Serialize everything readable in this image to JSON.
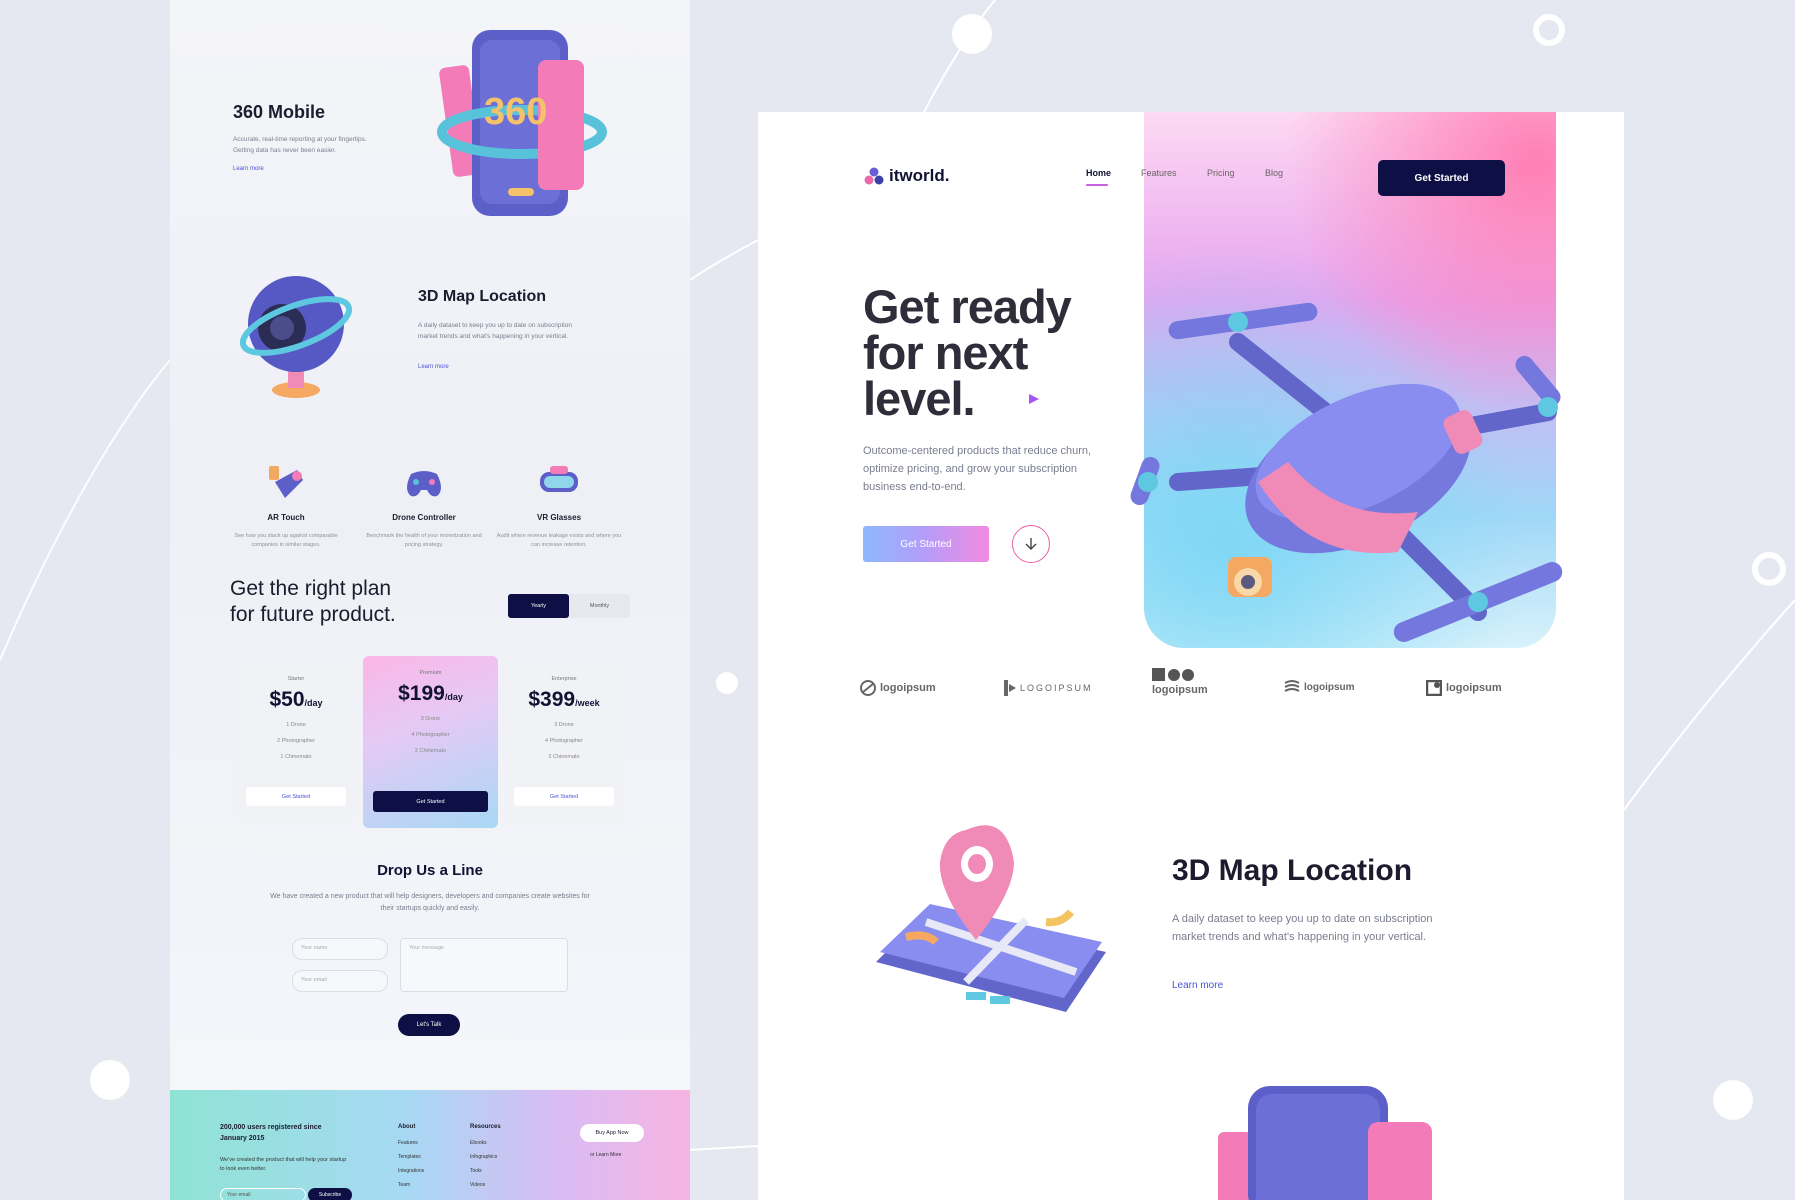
{
  "left": {
    "feature1": {
      "title": "360 Mobile",
      "desc": "Accurate, real-time reporting at your fingertips. Getting data has never been easier.",
      "link": "Learn more",
      "badge": "360"
    },
    "feature2": {
      "title": "3D Map Location",
      "desc": "A daily dataset to keep you up to date on subscription market trends and what's happening in your vertical.",
      "link": "Learn more"
    },
    "mini": [
      {
        "title": "AR Touch",
        "desc": "See how you stack up against comparable companies in similar stages."
      },
      {
        "title": "Drone Controller",
        "desc": "Benchmark the health of your monetization and pricing strategy."
      },
      {
        "title": "VR Glasses",
        "desc": "Audit where revenue leakage exists and where you can increase retention."
      }
    ],
    "plans": {
      "heading_line1": "Get the right plan",
      "heading_line2": "for future product.",
      "toggle_yearly": "Yearly",
      "toggle_monthly": "Monthly",
      "cards": [
        {
          "tier": "Starter",
          "price": "$50",
          "unit": "/day",
          "f1": "1 Drone",
          "f2": "2 Photographer",
          "f3": "1 Chinemato",
          "cta": "Get Started"
        },
        {
          "tier": "Premium",
          "price": "$199",
          "unit": "/day",
          "f1": "3 Drone",
          "f2": "4 Photographer",
          "f3": "2 Chinemato",
          "cta": "Get Started"
        },
        {
          "tier": "Enterprise",
          "price": "$399",
          "unit": "/week",
          "f1": "3 Drone",
          "f2": "4 Photographer",
          "f3": "2 Chinemato",
          "cta": "Get Started"
        }
      ]
    },
    "contact": {
      "title": "Drop Us a Line",
      "desc": "We have created a new product that will help designers, developers and companies create websites for their startups quickly and easily.",
      "name_placeholder": "Your name",
      "email_placeholder": "Your email",
      "message_placeholder": "Your message",
      "cta": "Let's Talk"
    },
    "footer": {
      "headline": "200,000 users registered since January 2015",
      "desc": "We've created the product that will help your startup to look even better.",
      "email_placeholder": "Your email",
      "subscribe": "Subscribe",
      "about": {
        "heading": "About",
        "items": [
          "Features",
          "Templates",
          "Integrations",
          "Team"
        ]
      },
      "resources": {
        "heading": "Resources",
        "items": [
          "Ebooks",
          "Infographics",
          "Tools",
          "Videos"
        ]
      },
      "buy": "Buy App Now",
      "learn": "or Learn More"
    }
  },
  "right": {
    "brand": "itworld.",
    "nav": [
      "Home",
      "Features",
      "Pricing",
      "Blog"
    ],
    "cta_top": "Get Started",
    "hero_line1": "Get ready",
    "hero_line2": "for next",
    "hero_line3": "level.",
    "hero_desc": "Outcome-centered products that reduce churn, optimize pricing, and grow your subscription business end-to-end.",
    "hero_cta": "Get Started",
    "logos": [
      "logoipsum",
      "LOGOIPSUM",
      "logoipsum",
      "logoipsum",
      "logoipsum"
    ],
    "map": {
      "title": "3D Map Location",
      "desc": "A daily dataset to keep you up to date on subscription market trends and what's happening in your vertical.",
      "link": "Learn more"
    }
  },
  "colors": {
    "navy": "#0d0f45",
    "accent": "#4b52d6",
    "pink": "#f28be1",
    "bg": "#e5e8f1"
  }
}
